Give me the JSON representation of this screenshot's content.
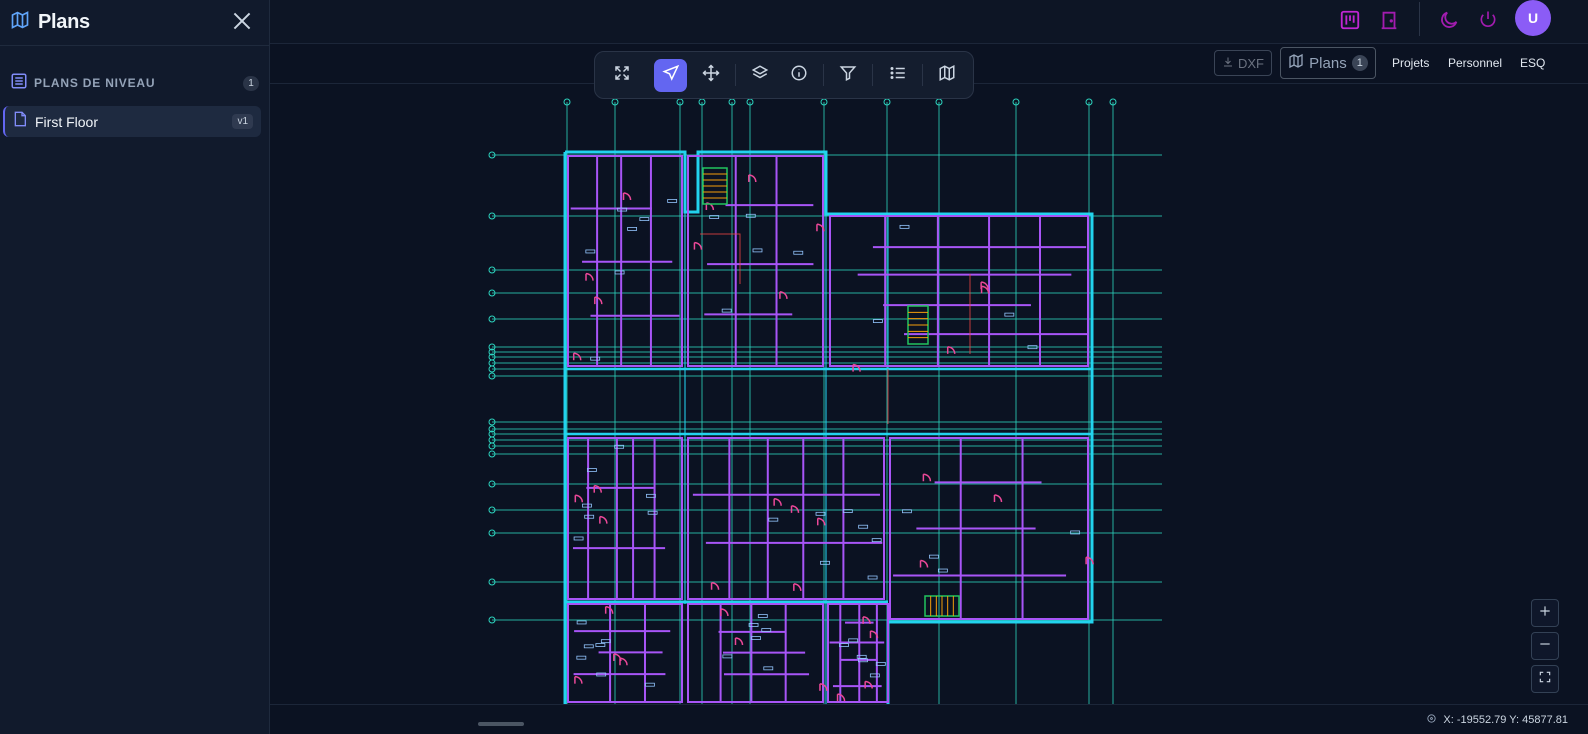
{
  "sidebar": {
    "title": "Plans",
    "section_label": "PLANS DE NIVEAU",
    "section_count": "1",
    "items": [
      {
        "label": "First Floor",
        "version": "v1"
      }
    ]
  },
  "topbar": {
    "avatar_initial": "U"
  },
  "subbar": {
    "dxf_label": "DXF",
    "plans_label": "Plans",
    "plans_count": "1",
    "links": [
      "Projets",
      "Personnel",
      "ESQ"
    ]
  },
  "toolbar": {
    "tools": [
      "fit-view",
      "select",
      "pan",
      "layers",
      "info",
      "filter",
      "list",
      "plans"
    ],
    "active_tool": "select"
  },
  "status": {
    "coords": "X: -19552.79 Y: 45877.81"
  },
  "colors": {
    "accent": "#6366f1",
    "wall_purple": "#a855f7",
    "wall_cyan": "#22d3ee",
    "grid_teal": "#2dd4bf",
    "door_pink": "#ec4899",
    "avatar": "#8b5cf6",
    "topbar_icon": "#c026d3"
  }
}
